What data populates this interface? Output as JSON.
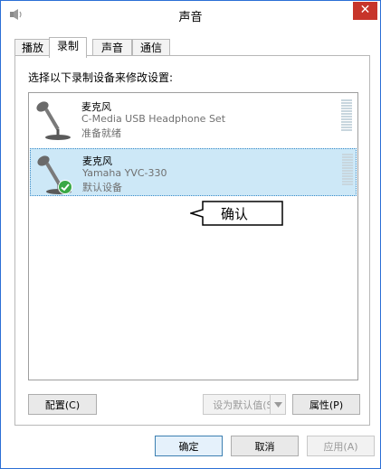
{
  "window": {
    "title": "声音",
    "close_glyph": "✕"
  },
  "tabs": [
    {
      "label": "播放"
    },
    {
      "label": "录制"
    },
    {
      "label": "声音"
    },
    {
      "label": "通信"
    }
  ],
  "instruction": "选择以下录制设备来修改设置:",
  "devices": [
    {
      "name": "麦克风",
      "description": "C-Media USB Headphone Set",
      "status": "准备就绪"
    },
    {
      "name": "麦克风",
      "description": "Yamaha YVC-330",
      "status": "默认设备"
    }
  ],
  "callout": {
    "text": "确认"
  },
  "panel_buttons": {
    "configure": "配置(C)",
    "set_default": "设为默认值(S)",
    "properties": "属性(P)"
  },
  "dialog_buttons": {
    "ok": "确定",
    "cancel": "取消",
    "apply": "应用(A)"
  },
  "colors": {
    "selection": "#cde8f7",
    "close_button": "#c7352a",
    "check_badge": "#3aa845"
  }
}
